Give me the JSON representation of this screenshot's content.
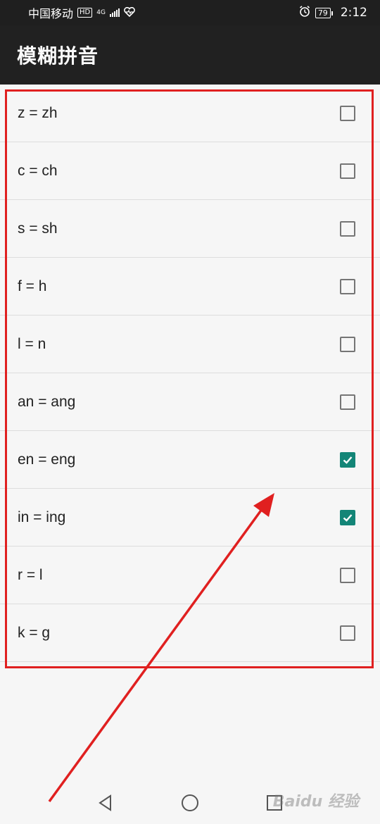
{
  "status_bar": {
    "carrier": "中国移动",
    "hd_badge": "HD",
    "network": "4G",
    "battery": "79",
    "time": "2:12",
    "icons": [
      "hd-icon",
      "signal-icon",
      "heart-icon",
      "alarm-icon",
      "battery-icon"
    ]
  },
  "app_bar": {
    "title": "模糊拼音"
  },
  "options": [
    {
      "label": "z = zh",
      "checked": false
    },
    {
      "label": "c = ch",
      "checked": false
    },
    {
      "label": "s = sh",
      "checked": false
    },
    {
      "label": "f = h",
      "checked": false
    },
    {
      "label": "l = n",
      "checked": false
    },
    {
      "label": "an = ang",
      "checked": false
    },
    {
      "label": "en = eng",
      "checked": true
    },
    {
      "label": "in = ing",
      "checked": true
    },
    {
      "label": "r = l",
      "checked": false
    },
    {
      "label": "k = g",
      "checked": false
    }
  ],
  "nav_bar": {
    "icons": [
      "back-icon",
      "home-icon",
      "recents-icon"
    ]
  },
  "watermark": "Baidu 经验",
  "colors": {
    "accent": "#138577",
    "annotation": "#e02020",
    "app_bar": "#212121"
  }
}
